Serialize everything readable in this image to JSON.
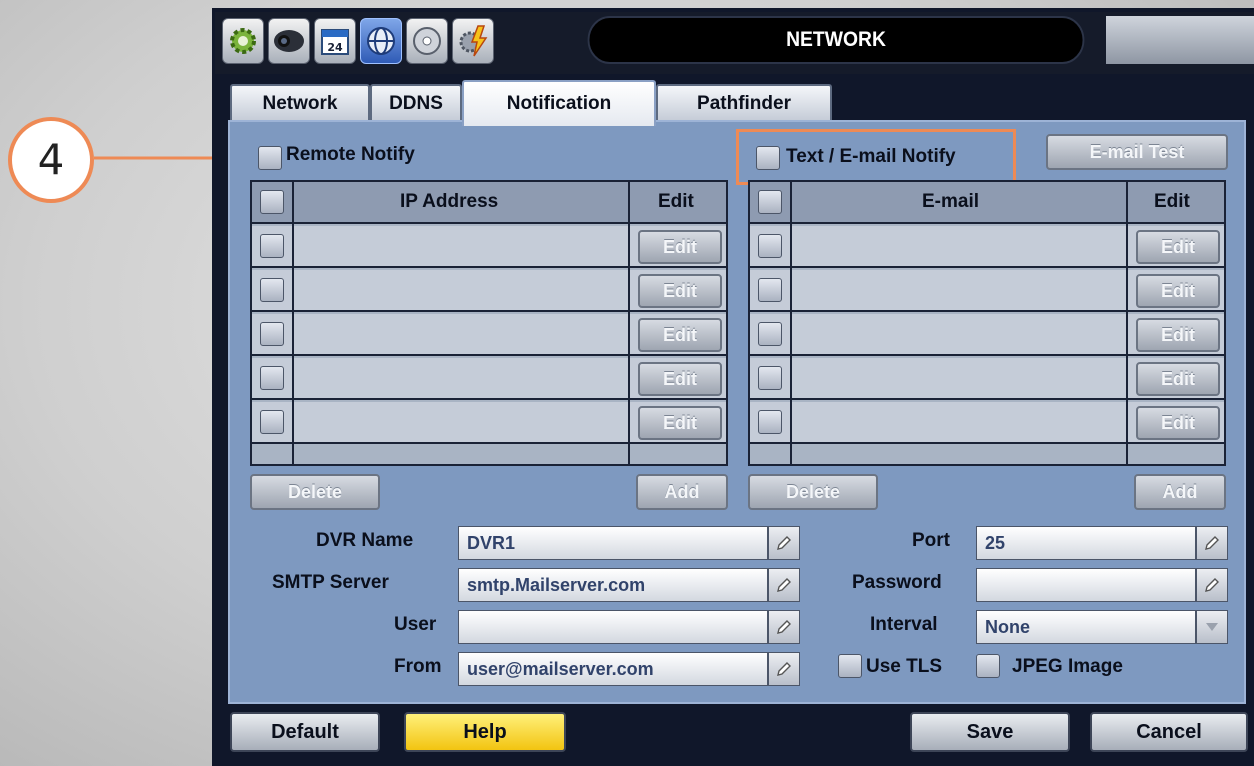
{
  "callout": {
    "number": "4"
  },
  "toolbar": {
    "title": "NETWORK",
    "icons": [
      "gear-icon",
      "camera-icon",
      "calendar-icon",
      "network-globe-icon",
      "disc-icon",
      "event-gear-icon"
    ],
    "calendar_day": "24"
  },
  "tabs": [
    {
      "label": "Network",
      "active": false
    },
    {
      "label": "DDNS",
      "active": false
    },
    {
      "label": "Notification",
      "active": true
    },
    {
      "label": "Pathfinder",
      "active": false
    }
  ],
  "remote": {
    "toggle_label": "Remote Notify",
    "col_address": "IP Address",
    "col_edit": "Edit",
    "row_button": "Edit",
    "rows": 5,
    "delete_label": "Delete",
    "add_label": "Add"
  },
  "email": {
    "toggle_label": "Text / E-mail Notify",
    "test_label": "E-mail Test",
    "col_email": "E-mail",
    "col_edit": "Edit",
    "row_button": "Edit",
    "rows": 5,
    "delete_label": "Delete",
    "add_label": "Add"
  },
  "settings": {
    "dvr_name_label": "DVR Name",
    "dvr_name_value": "DVR1",
    "smtp_label": "SMTP Server",
    "smtp_value": "smtp.Mailserver.com",
    "user_label": "User",
    "user_value": "",
    "from_label": "From",
    "from_value": "user@mailserver.com",
    "port_label": "Port",
    "port_value": "25",
    "password_label": "Password",
    "password_value": "",
    "interval_label": "Interval",
    "interval_value": "None",
    "tls_label": "Use TLS",
    "jpeg_label": "JPEG Image"
  },
  "footer": {
    "default_label": "Default",
    "help_label": "Help",
    "save_label": "Save",
    "cancel_label": "Cancel"
  },
  "colors": {
    "panel": "#7e99c0",
    "callout": "#ee8a55",
    "help": "#f2c411"
  }
}
